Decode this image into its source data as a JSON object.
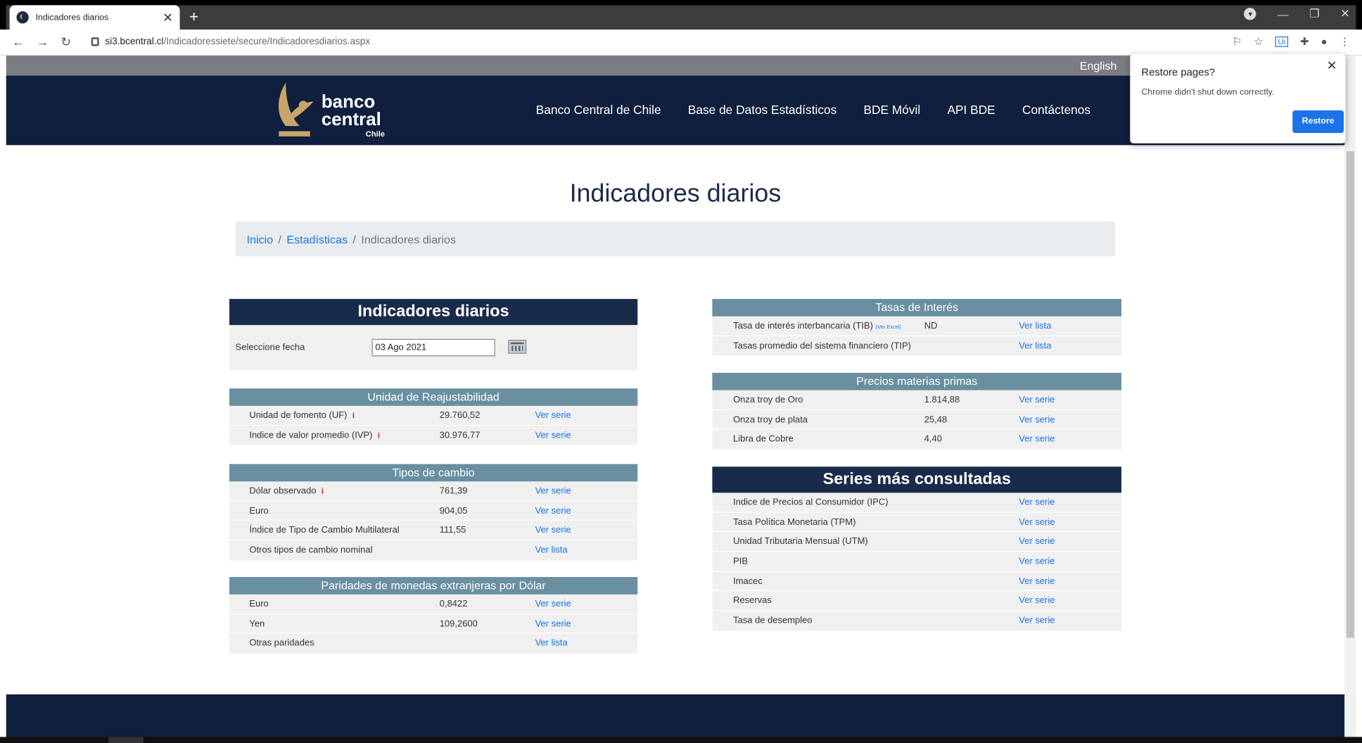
{
  "browser": {
    "tab_title": "Indicadores diarios",
    "url_host": "si3.bcentral.cl",
    "url_path": "/Indicadoressiete/secure/Indicadoresdiarios.aspx"
  },
  "site": {
    "lang_link": "English",
    "logo_line1": "banco",
    "logo_line2": "central",
    "logo_line3": "Chile",
    "nav": [
      "Banco Central de Chile",
      "Base de Datos Estadísticos",
      "BDE Móvil",
      "API BDE",
      "Contáctenos"
    ]
  },
  "page": {
    "title": "Indicadores diarios",
    "breadcrumb": [
      "Inicio",
      "Estadísticas",
      "Indicadores diarios"
    ],
    "breadcrumb_sep": "/"
  },
  "left": {
    "main_title": "Indicadores diarios",
    "date_label": "Seleccione fecha",
    "date_value": "03 Ago 2021",
    "uf_section": {
      "title": "Unidad de Reajustabilidad",
      "rows": [
        {
          "name": "Unidad de fomento (UF)",
          "info": "i",
          "value": "29.760,52",
          "link": "Ver serie"
        },
        {
          "name": "Indice de valor promedio (IVP)",
          "info": "i",
          "value": "30.976,77",
          "link": "Ver serie"
        }
      ]
    },
    "tc_section": {
      "title": "Tipos de cambio",
      "rows": [
        {
          "name": "Dólar observado",
          "info": "i",
          "value": "761,39",
          "link": "Ver serie"
        },
        {
          "name": "Euro",
          "info": "",
          "value": "904,05",
          "link": "Ver serie"
        },
        {
          "name": "Índice de Tipo de Cambio Multilateral",
          "info": "",
          "value": "111,55",
          "link": "Ver serie"
        },
        {
          "name": "Otros tipos de cambio nominal",
          "info": "",
          "value": "",
          "link": "Ver lista"
        }
      ]
    },
    "par_section": {
      "title": "Paridades de monedas extranjeras por Dólar",
      "rows": [
        {
          "name": "Euro",
          "value": "0,8422",
          "link": "Ver serie"
        },
        {
          "name": "Yen",
          "value": "109,2600",
          "link": "Ver serie"
        },
        {
          "name": "Otras paridades",
          "value": "",
          "link": "Ver lista"
        }
      ]
    }
  },
  "right": {
    "tasas_section": {
      "title": "Tasas de Interés",
      "rows": [
        {
          "name": "Tasa de interés interbancaria (TIB)",
          "extra": "(Ver Excel)",
          "value": "ND",
          "link": "Ver lista"
        },
        {
          "name": "Tasas promedio del sistema financiero (TIP)",
          "extra": "",
          "value": "",
          "link": "Ver lista"
        }
      ]
    },
    "precios_section": {
      "title": "Precios materias primas",
      "rows": [
        {
          "name": "Onza troy de Oro",
          "value": "1.814,88",
          "link": "Ver serie"
        },
        {
          "name": "Onza troy de plata",
          "value": "25,48",
          "link": "Ver serie"
        },
        {
          "name": "Libra de Cobre",
          "value": "4,40",
          "link": "Ver serie"
        }
      ]
    },
    "series_section": {
      "title": "Series más consultadas",
      "rows": [
        {
          "name": "Indice de Precios al Consumidor (IPC)",
          "link": "Ver serie"
        },
        {
          "name": "Tasa Política Monetaria (TPM)",
          "link": "Ver serie"
        },
        {
          "name": "Unidad Tributaria Mensual (UTM)",
          "link": "Ver serie"
        },
        {
          "name": "PIB",
          "link": "Ver serie"
        },
        {
          "name": "Imacec",
          "link": "Ver serie"
        },
        {
          "name": "Reservas",
          "link": "Ver serie"
        },
        {
          "name": "Tasa de desempleo",
          "link": "Ver serie"
        }
      ]
    }
  },
  "popup": {
    "title": "Restore pages?",
    "message": "Chrome didn't shut down correctly.",
    "button": "Restore"
  },
  "colors": {
    "navy": "#0f1f3d",
    "section_header": "#698fa1",
    "link": "#1a73e8",
    "info": "#c0202a",
    "gold": "#c9a46a"
  }
}
